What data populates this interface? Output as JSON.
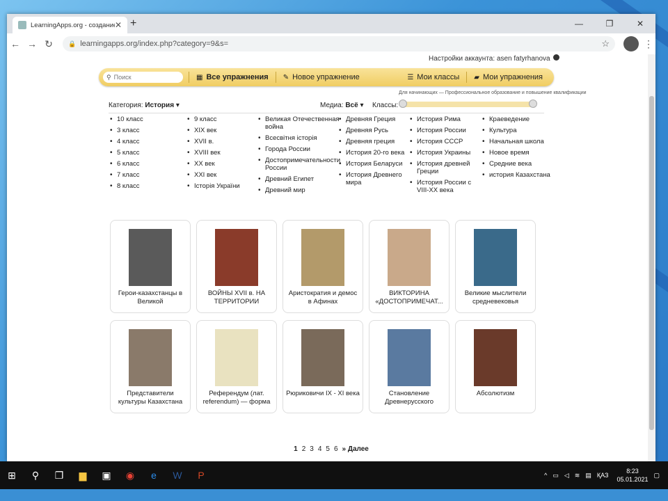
{
  "browser": {
    "tab_title": "LearningApps.org - создание му",
    "url": "learningapps.org/index.php?category=9&s="
  },
  "account_text": "Настройки аккаунта: asen fatyrhanova",
  "topbar": {
    "search_placeholder": "Поиск",
    "all_exercises": "Все упражнения",
    "new_exercise": "Новое упражнение",
    "my_classes": "Мои классы",
    "my_exercises": "Мои упражнения"
  },
  "filters": {
    "category_label": "Категория:",
    "category_value": "История",
    "media_label": "Медиа:",
    "media_value": "Всё",
    "classes_label": "Классы:",
    "level_hint": "Для начинающих — Профессиональное образование и повышение квалификации"
  },
  "categories": [
    [
      "10 класс",
      "3 класс",
      "4 класс",
      "5 класс",
      "6 класс",
      "7 класс",
      "8 класс"
    ],
    [
      "9 класс",
      "XIX век",
      "XVII в.",
      "XVIII век",
      "XX век",
      "XXI век",
      "Історія України"
    ],
    [
      "Великая Отечественная война",
      "Всесвітня історія",
      "Города России",
      "Достопримечательности России",
      "Древний Египет",
      "Древний мир"
    ],
    [
      "Древняя Греция",
      "Древняя Русь",
      "Древняя греция",
      "История 20-го века",
      "История Беларуси",
      "История Древнего мира"
    ],
    [
      "История Рима",
      "История России",
      "История СССР",
      "История Украины",
      "История древней Греции",
      "История России с VIII-XX века"
    ],
    [
      "Краеведение",
      "Культура",
      "Начальная школа",
      "Новое время",
      "Средние века",
      "история Казахстана"
    ]
  ],
  "cards": [
    {
      "label": "Герои-казахстанцы в Великой",
      "icon": "portrait-photo"
    },
    {
      "label": "ВОЙНЫ XVII в. НА ТЕРРИТОРИИ",
      "icon": "portrait-painting"
    },
    {
      "label": "Аристократия и демос в Афинах",
      "icon": "crowd-painting"
    },
    {
      "label": "ВИКТОРИНА «ДОСТОПРИМЕЧАТ...",
      "icon": "city-map"
    },
    {
      "label": "Великие мыслители средневековья",
      "icon": "scholar-portrait"
    },
    {
      "label": "Представители культуры Казахстана",
      "icon": "portrait-grid"
    },
    {
      "label": "Референдум (лат. referendum) — форма",
      "icon": "document-cover"
    },
    {
      "label": "Рюриковичи IX - XI века",
      "icon": "engraved-portrait"
    },
    {
      "label": "Становление Древнерусского",
      "icon": "warrior-figure"
    },
    {
      "label": "Абсолютизм",
      "icon": "king-portrait"
    }
  ],
  "pager": {
    "pages": [
      "1",
      "2",
      "3",
      "4",
      "5",
      "6"
    ],
    "next": "» Далее"
  },
  "taskbar": {
    "lang": "ҚАЗ",
    "time": "8:23",
    "date": "05.01.2021"
  },
  "colors": {
    "topbar": "#f0cd62",
    "desktop": "#3a8fd4",
    "taskbar": "#101010"
  }
}
